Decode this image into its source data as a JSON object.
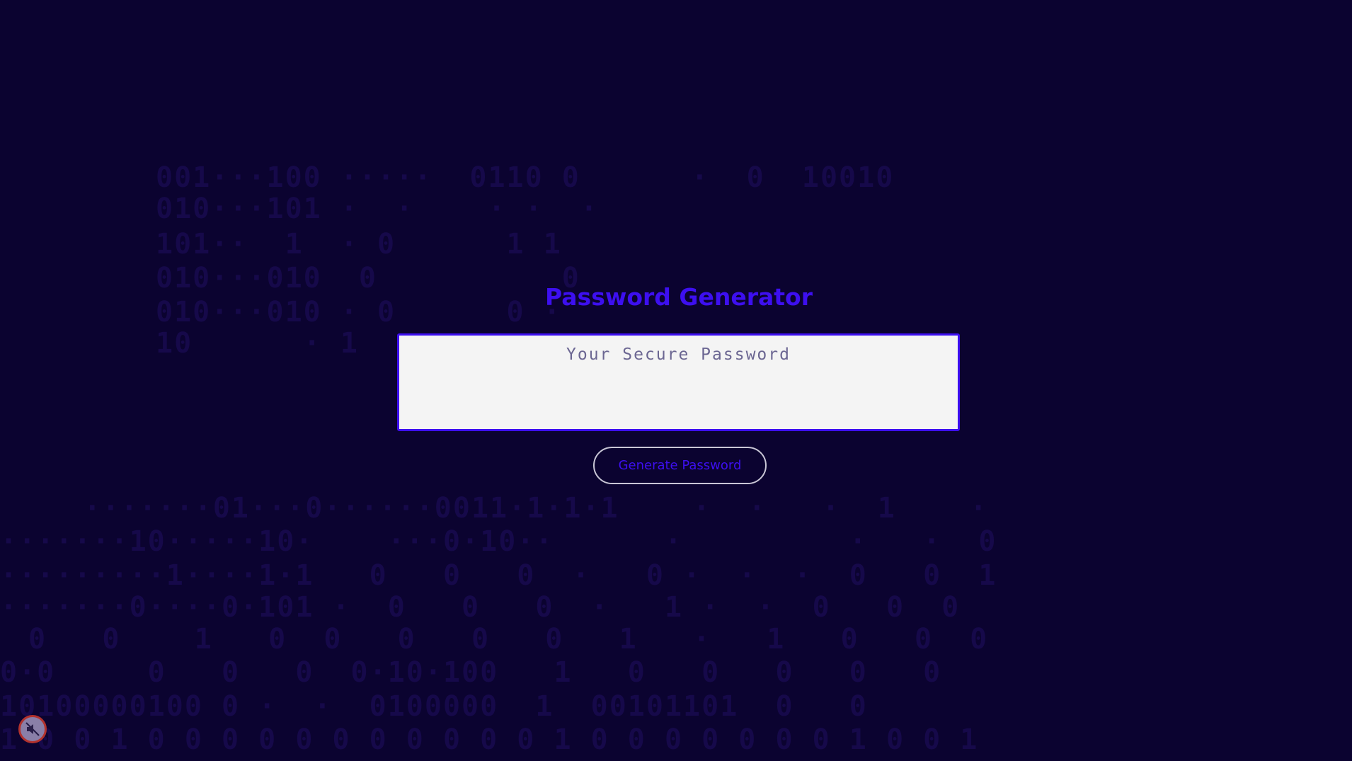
{
  "app": {
    "title": "Password Generator"
  },
  "password_field": {
    "value": "",
    "placeholder": "Your Secure Password"
  },
  "actions": {
    "generate_label": "Generate Password"
  },
  "audio": {
    "state": "muted",
    "icon": "speaker-muted-icon"
  },
  "colors": {
    "background": "#0b0330",
    "accent": "#3d0ff0",
    "field_bg": "#f4f4f4",
    "placeholder": "#6b6692",
    "button_border": "#c9c6d6",
    "mute_ring": "#b2322d"
  }
}
